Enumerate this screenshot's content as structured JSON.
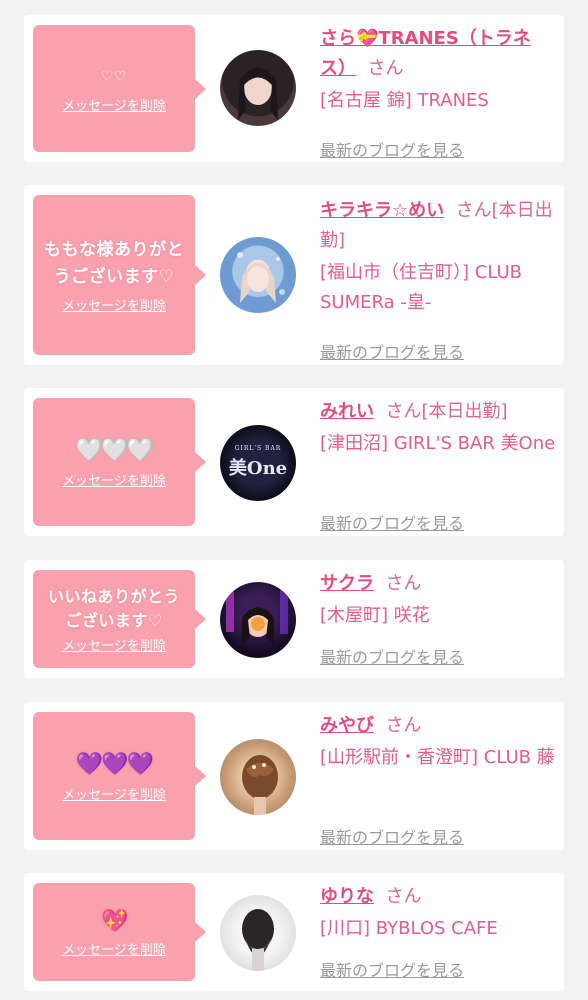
{
  "delete_label": "メッセージを削除",
  "blog_label": "最新のブログを見る",
  "san_suffix": "さん",
  "entries": [
    {
      "message": "♡♡",
      "name": "さら💝TRANES（トラネス）",
      "honorific": "さん",
      "shop": "[名古屋 錦] TRANES",
      "avatar_icon": "woman-portrait-dark-hair"
    },
    {
      "message": "ももな様ありがとうございます♡",
      "name": "キラキラ☆めい",
      "honorific": "さん[本日出勤]",
      "shop": "[福山市（住吉町）] CLUB SUMERa -皇-",
      "avatar_icon": "woman-portrait-blonde"
    },
    {
      "message": "🤍🤍🤍",
      "name": "みれい",
      "honorific": "さん[本日出勤]",
      "shop": "[津田沼] GIRL'S BAR 美One",
      "avatar_icon": "girls-bar-logo",
      "avatar_logo_small": "GIRL'S BAR",
      "avatar_logo_big": "美One"
    },
    {
      "message": "いいねありがとうございます♡",
      "name": "サクラ",
      "honorific": "さん",
      "shop": "[木屋町] 咲花",
      "avatar_icon": "woman-portrait-neon"
    },
    {
      "message": "💜💜💜",
      "name": "みやび",
      "honorific": "さん",
      "shop": "[山形駅前・香澄町] CLUB 藤",
      "avatar_icon": "hair-updo-photo"
    },
    {
      "message": "💖",
      "name": "ゆりな",
      "honorific": "さん",
      "shop": "[川口] BYBLOS CAFE",
      "avatar_icon": "hair-back-photo"
    }
  ]
}
